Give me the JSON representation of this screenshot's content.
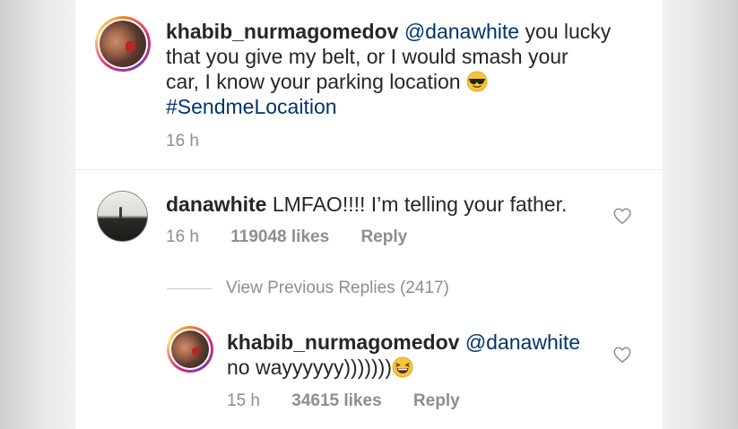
{
  "caption": {
    "username": "khabib_nurmagomedov",
    "mention": "@danawhite",
    "text_line1": "you lucky",
    "text_line2": "that you give my belt, or I would smash your",
    "text_line3": "car, I know your parking location",
    "emoji": "sunglasses-face",
    "hashtag": "#SendmeLocaition",
    "time": "16 h"
  },
  "comment": {
    "username": "danawhite",
    "text": "LMFAO!!!! I’m telling your father.",
    "time": "16 h",
    "likes": "119048 likes",
    "reply_label": "Reply"
  },
  "view_previous": "View Previous Replies (2417)",
  "reply": {
    "username": "khabib_nurmagomedov",
    "mention": "@danawhite",
    "text": "no wayyyyyy)))))))",
    "emoji": "grinning-squinting-face",
    "time": "15 h",
    "likes": "34615 likes",
    "reply_label": "Reply"
  },
  "colors": {
    "mention": "#003569",
    "meta": "#8e8e8e",
    "text": "#262626"
  }
}
